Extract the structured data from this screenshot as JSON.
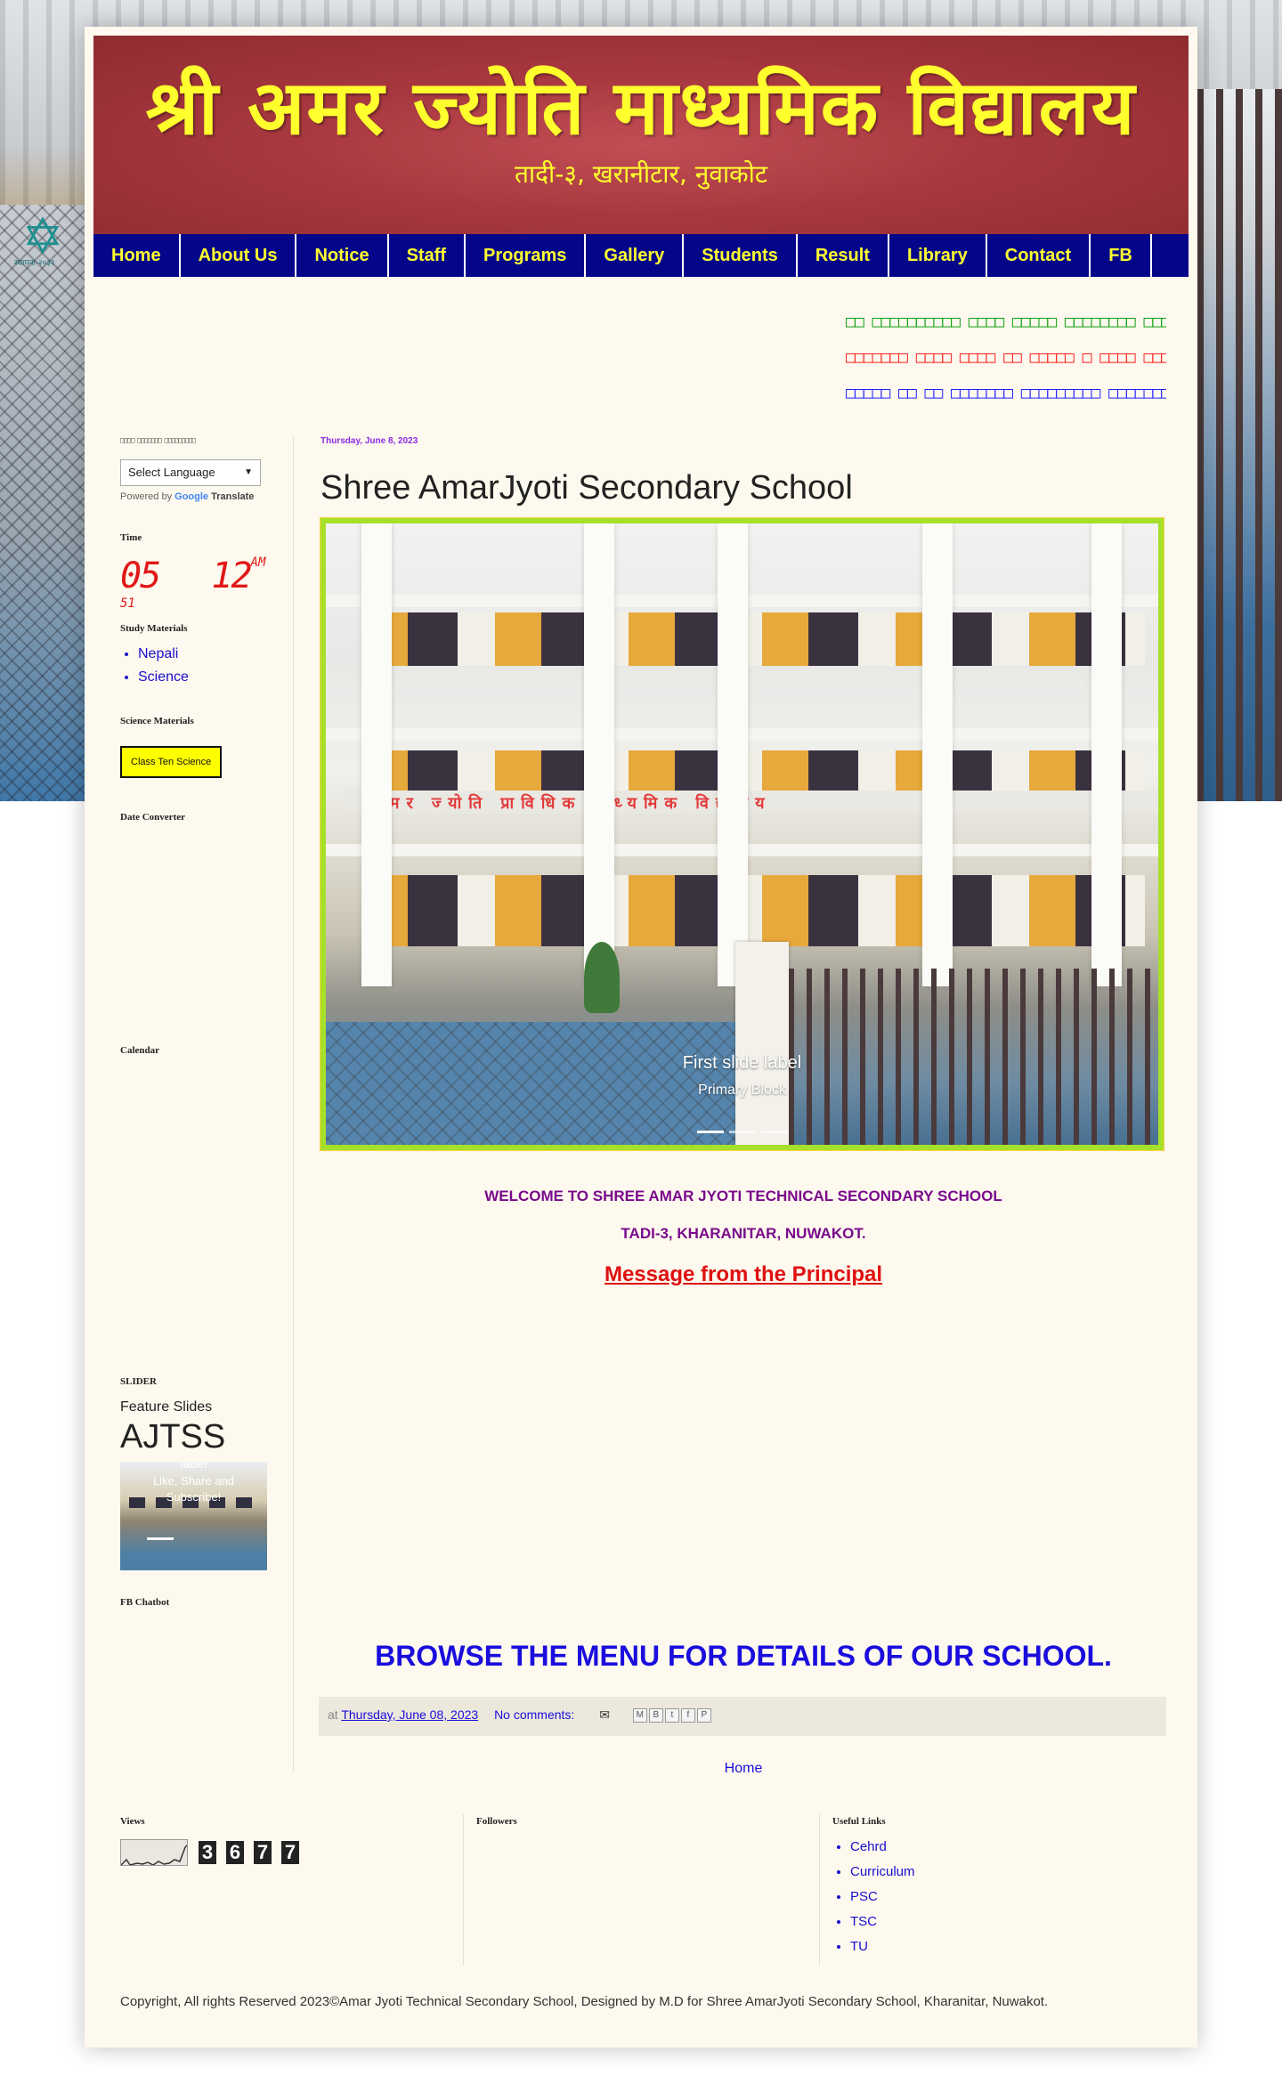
{
  "header": {
    "title": "श्री अमर ज्योति माध्यमिक विद्यालय",
    "subtitle": "तादी-३, खरानीटार, नुवाकोट",
    "emblem_text": "स्थापना-२०३२"
  },
  "nav": {
    "items": [
      {
        "label": "Home"
      },
      {
        "label": "About Us"
      },
      {
        "label": "Notice"
      },
      {
        "label": "Staff"
      },
      {
        "label": "Programs"
      },
      {
        "label": "Gallery"
      },
      {
        "label": "Students"
      },
      {
        "label": "Result"
      },
      {
        "label": "Library"
      },
      {
        "label": "Contact"
      },
      {
        "label": "FB"
      }
    ],
    "bg_color": "#05058a",
    "text_color": "#ffff2e"
  },
  "marquee": {
    "line1": "□□ □□□□□□□□□□ □□□□ □□□□□ □□□□□□□□ □□□□□□□□",
    "line2": "□□□□□□□ □□□□ □□□□ □□ □□□□□ □ □□□□ □□□□□ □□",
    "line3": "□□□□□ □□ □□ □□□□□□□ □□□□□□□□□ □□□□□□□□ □□□"
  },
  "sidebar": {
    "translate_title": "□□□□ □□□□□□□ □□□□□□□□□",
    "language_select": "Select Language",
    "powered_by": "Powered by",
    "google": "Google",
    "translate": "Translate",
    "time_title": "Time",
    "clock": {
      "hours": "05",
      "minutes": "12",
      "ampm": "AM",
      "seconds": "51"
    },
    "study_title": "Study Materials",
    "study_links": [
      "Nepali",
      "Science"
    ],
    "science_title": "Science Materials",
    "science_button": "Class Ten Science",
    "date_converter_title": "Date Converter",
    "calendar_title": "Calendar",
    "slider_title": "SLIDER",
    "feature_slides": "Feature Slides",
    "ajtss": "AJTSS",
    "slider_caption1": "label",
    "slider_caption2": "Like, Share and",
    "slider_caption3": "Subscribe!",
    "fb_chatbot_title": "FB Chatbot"
  },
  "post": {
    "date_header": "Thursday, June 8, 2023",
    "title": "Shree AmarJyoti Secondary School",
    "carousel": {
      "caption_title": "First slide label",
      "caption_sub": "Primary Block",
      "prev": "‹",
      "next": "›",
      "active_index": 0,
      "slide_count": 3
    },
    "welcome": "WELCOME TO SHREE AMAR JYOTI TECHNICAL SECONDARY SCHOOL",
    "address": "TADI-3, KHARANITAR, NUWAKOT.",
    "principal_link": "Message from the Principal",
    "browse": "BROWSE THE MENU FOR DETAILS OF OUR SCHOOL.",
    "footer": {
      "at": "at",
      "timestamp": "Thursday, June 08, 2023",
      "comments": "No comments:"
    },
    "home_link": "Home"
  },
  "footer": {
    "views_title": "Views",
    "views_digits": [
      "3",
      "6",
      "7",
      "7"
    ],
    "followers_title": "Followers",
    "useful_title": "Useful Links",
    "useful_links": [
      "Cehrd",
      "Curriculum",
      "PSC",
      "TSC",
      "TU"
    ],
    "copyright": "Copyright, All rights Reserved 2023©Amar Jyoti Technical Secondary School, Designed by M.D for Shree AmarJyoti Secondary School, Kharanitar, Nuwakot."
  },
  "colors": {
    "header_red": "#a8383f",
    "title_yellow": "#ffff2e",
    "link_blue": "#1a0ddd",
    "welcome_purple": "#7a0a8c",
    "principal_red": "#e01010"
  }
}
